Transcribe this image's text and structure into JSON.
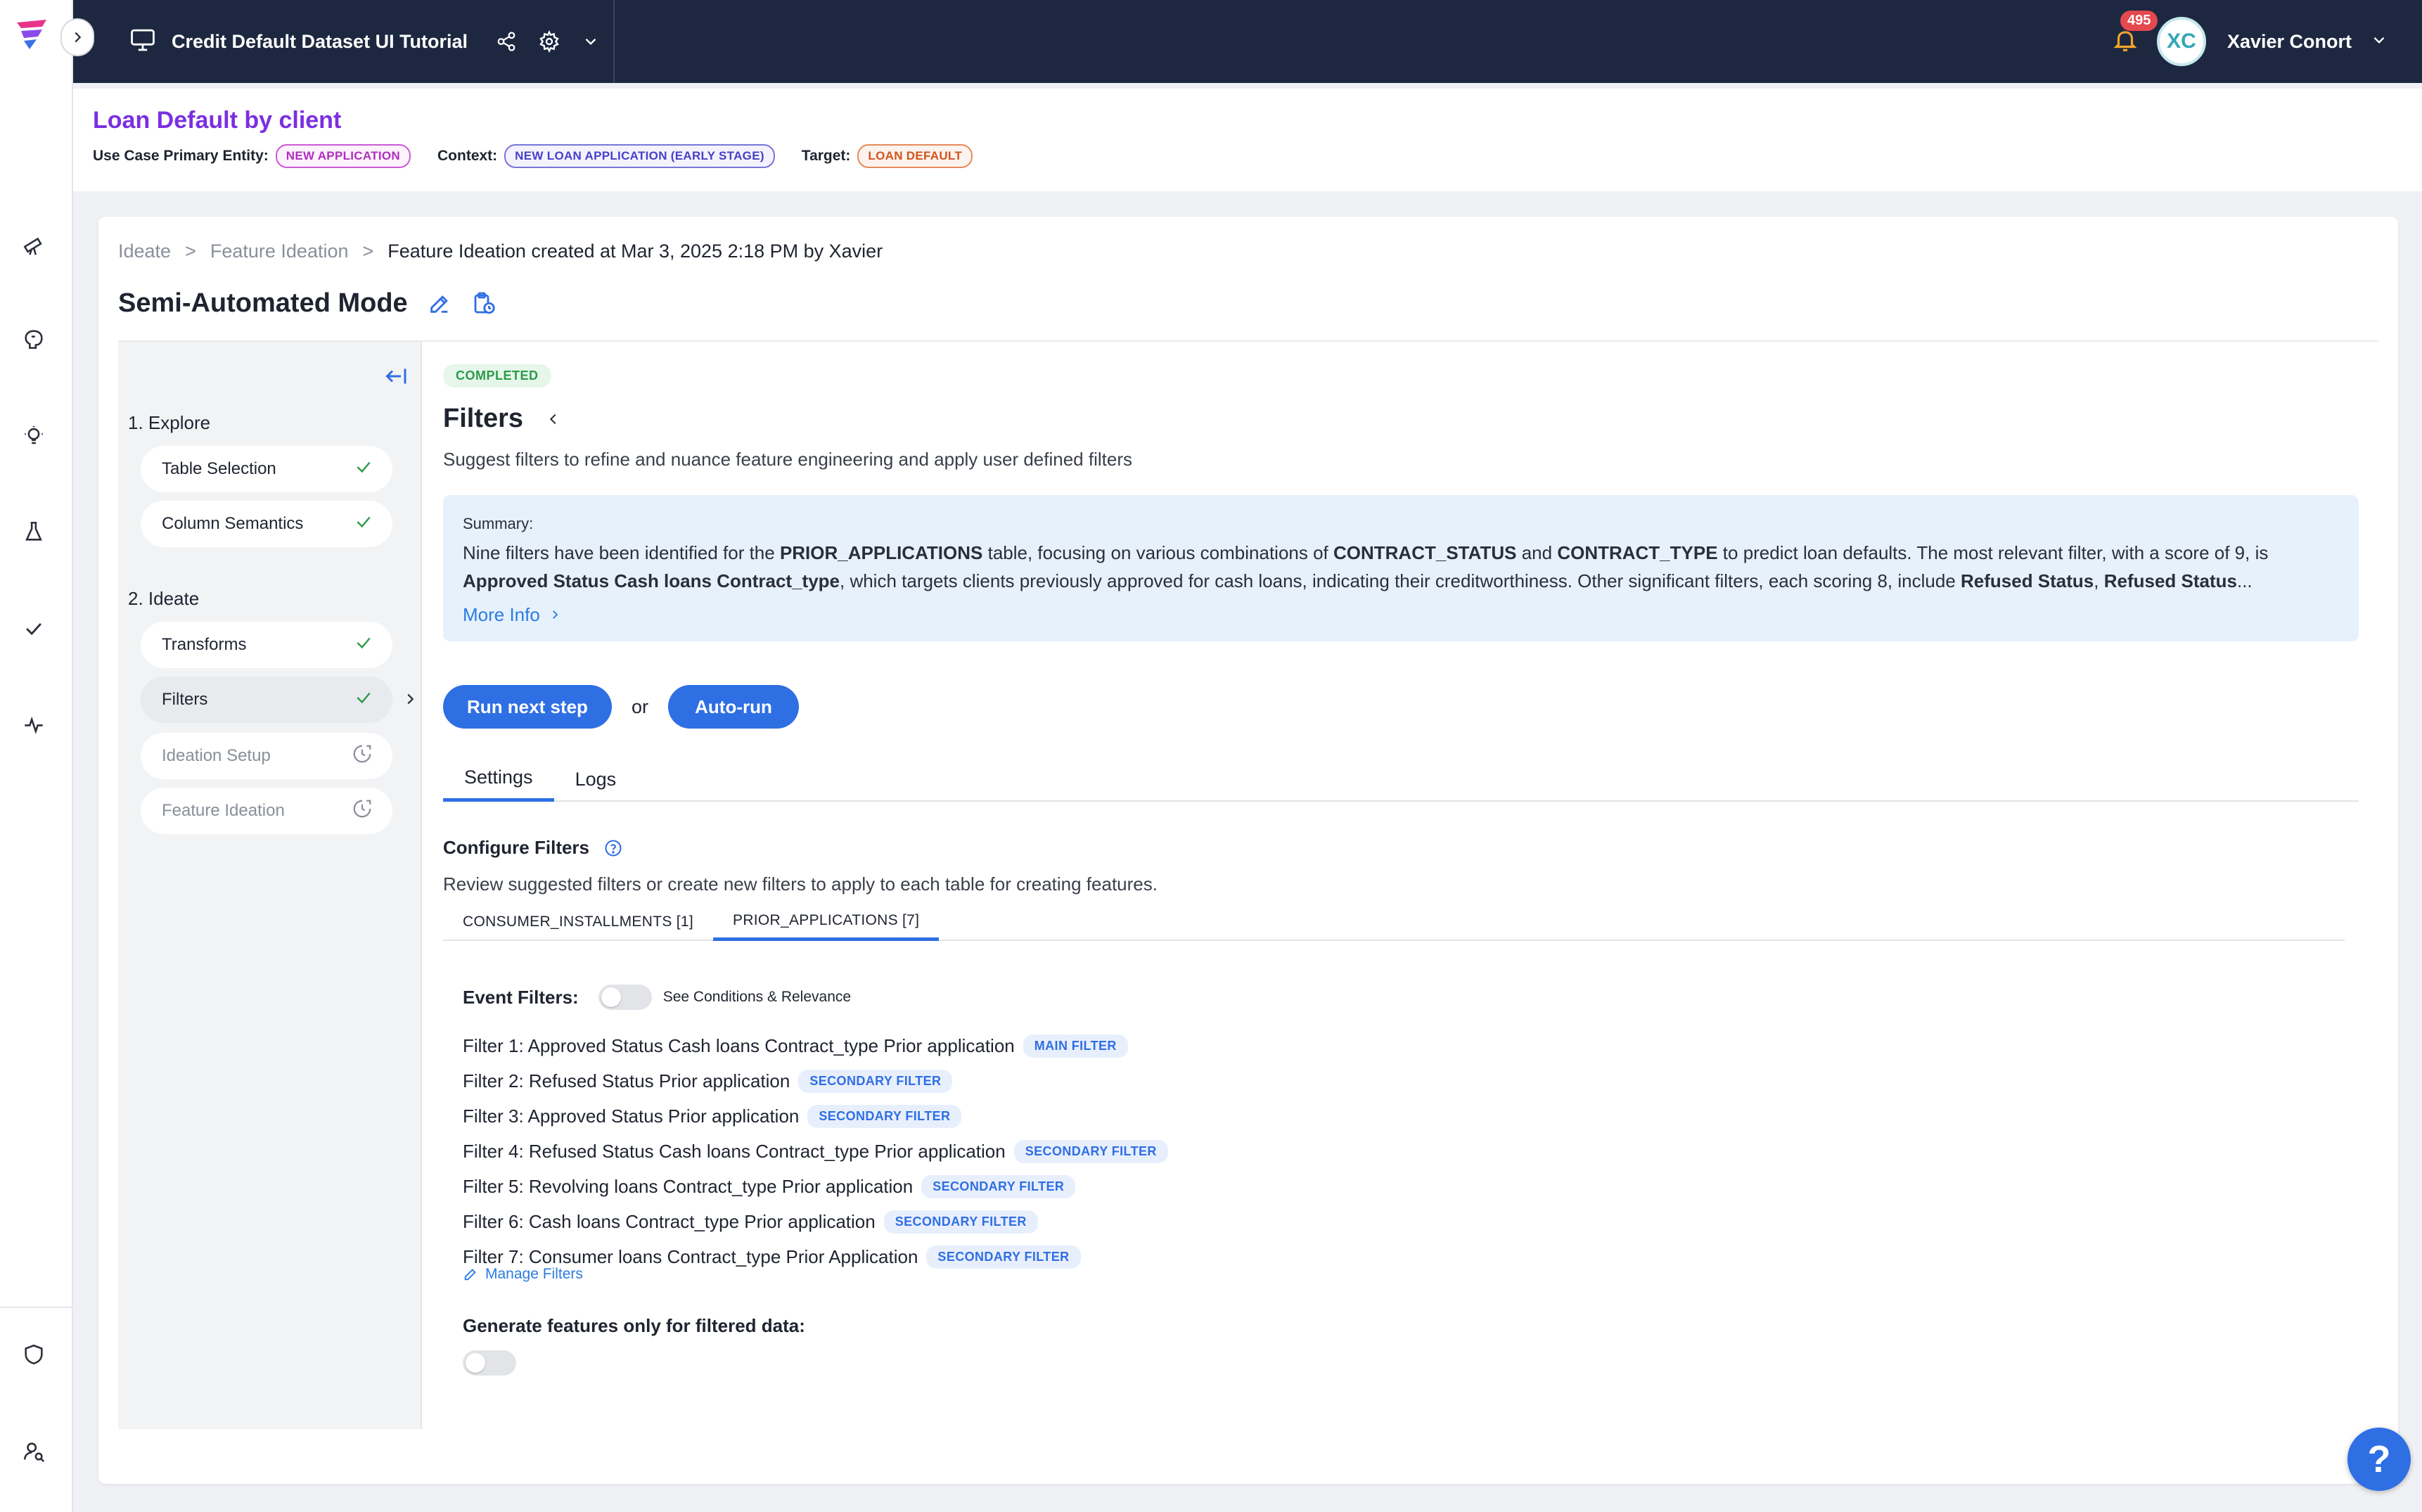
{
  "topbar": {
    "project_title": "Credit Default Dataset UI Tutorial",
    "notification_count": "495",
    "user_initials": "XC",
    "user_name": "Xavier Conort"
  },
  "usecase": {
    "title": "Loan Default by client",
    "primary_entity_label": "Use Case Primary Entity:",
    "primary_entity_value": "NEW APPLICATION",
    "context_label": "Context:",
    "context_value": "NEW LOAN APPLICATION (EARLY STAGE)",
    "target_label": "Target:",
    "target_value": "LOAN DEFAULT"
  },
  "breadcrumb": {
    "items": [
      "Ideate",
      "Feature Ideation"
    ],
    "separator": ">",
    "current": "Feature Ideation created at Mar 3, 2025 2:18 PM by Xavier"
  },
  "mode_title": "Semi-Automated Mode",
  "steps": {
    "group1": "1. Explore",
    "group2": "2. Ideate",
    "items": [
      {
        "label": "Table Selection",
        "status": "done"
      },
      {
        "label": "Column Semantics",
        "status": "done"
      },
      {
        "label": "Transforms",
        "status": "done"
      },
      {
        "label": "Filters",
        "status": "done"
      },
      {
        "label": "Ideation Setup",
        "status": "pending"
      },
      {
        "label": "Feature Ideation",
        "status": "pending"
      }
    ]
  },
  "content": {
    "status": "COMPLETED",
    "title": "Filters",
    "subtitle": "Suggest filters to refine and nuance feature engineering and apply user defined filters",
    "summary_label": "Summary:",
    "summary_p1": "Nine filters have been identified for the ",
    "summary_b1": "PRIOR_APPLICATIONS",
    "summary_p2": " table, focusing on various combinations of ",
    "summary_b2": "CONTRACT_STATUS",
    "summary_p3": " and ",
    "summary_b3": "CONTRACT_TYPE",
    "summary_p4": " to predict loan defaults. The most relevant filter, with a score of 9, is",
    "summary_b4": "Approved Status Cash loans Contract_type",
    "summary_p5": ", which targets clients previously approved for cash loans, indicating their creditworthiness. Other significant filters, each scoring 8, include ",
    "summary_b5": "Refused Status",
    "summary_p6": ", ",
    "summary_b6": "Refused Status",
    "summary_ellipsis": "...",
    "more_info": "More Info",
    "run_next": "Run next step",
    "or": "or",
    "auto_run": "Auto-run",
    "tabs": [
      "Settings",
      "Logs"
    ],
    "configure_title": "Configure Filters",
    "configure_sub": "Review suggested filters or create new filters to apply to each table for creating features.",
    "table_tabs": [
      "CONSUMER_INSTALLMENTS [1]",
      "PRIOR_APPLICATIONS [7]"
    ],
    "event_filters_label": "Event Filters:",
    "see_conditions": "See Conditions & Relevance",
    "filters": [
      {
        "label": "Filter 1: Approved Status Cash loans Contract_type Prior application",
        "tag": "MAIN FILTER"
      },
      {
        "label": "Filter 2: Refused Status Prior application",
        "tag": "SECONDARY FILTER"
      },
      {
        "label": "Filter 3: Approved Status Prior application",
        "tag": "SECONDARY FILTER"
      },
      {
        "label": "Filter 4: Refused Status Cash loans Contract_type Prior application",
        "tag": "SECONDARY FILTER"
      },
      {
        "label": "Filter 5: Revolving loans Contract_type Prior application",
        "tag": "SECONDARY FILTER"
      },
      {
        "label": "Filter 6: Cash loans Contract_type Prior application",
        "tag": "SECONDARY FILTER"
      },
      {
        "label": "Filter 7: Consumer loans Contract_type Prior Application",
        "tag": "SECONDARY FILTER"
      }
    ],
    "manage_filters": "Manage Filters",
    "generate_label": "Generate features only for filtered data:"
  },
  "help": "?"
}
